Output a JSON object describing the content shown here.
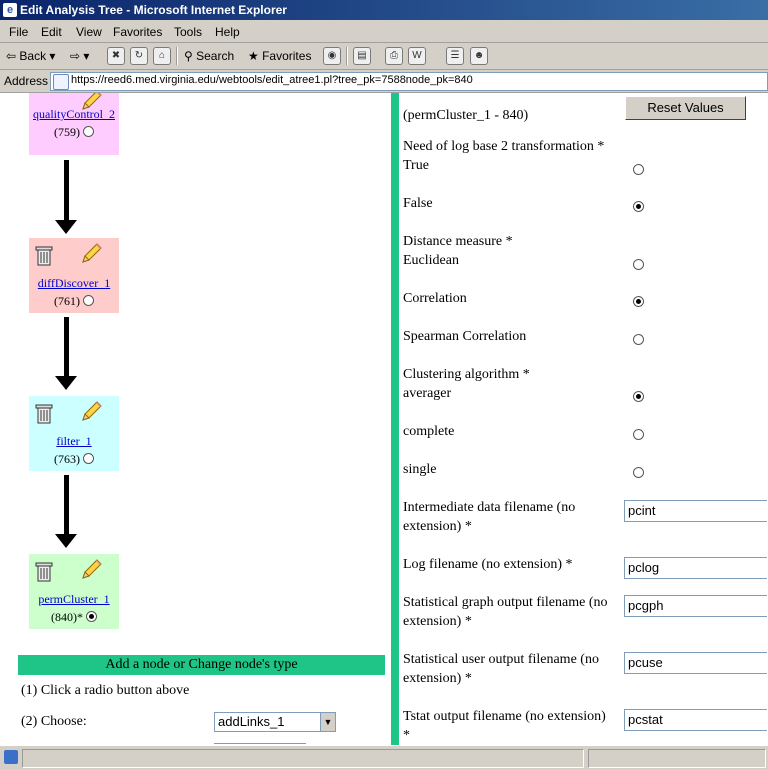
{
  "window": {
    "title": "Edit Analysis Tree - Microsoft Internet Explorer"
  },
  "menu": [
    "File",
    "Edit",
    "View",
    "Favorites",
    "Tools",
    "Help"
  ],
  "toolbar": {
    "back": "Back",
    "search": "Search",
    "favorites": "Favorites"
  },
  "address": {
    "label": "Address",
    "url": "https://reed6.med.virginia.edu/webtools/edit_atree1.pl?tree_pk=7588node_pk=840"
  },
  "tree": {
    "nodes": [
      {
        "name": "qualityControl_2",
        "id": "(759)",
        "color": "#ffccff",
        "selected": false
      },
      {
        "name": "diffDiscover_1",
        "id": "(761)",
        "color": "#ffcccc",
        "selected": false
      },
      {
        "name": "filter_1",
        "id": "(763)",
        "color": "#ccffff",
        "selected": false
      },
      {
        "name": "permCluster_1",
        "id": "(840)*",
        "color": "#ccffcc",
        "selected": true
      }
    ],
    "add_node_header": "Add a node or Change node's type",
    "step1": "(1) Click a radio button above",
    "step2": "(2) Choose:",
    "choose_value": "addLinks_1"
  },
  "form": {
    "reset_label": "Reset Values",
    "node_heading": "(permCluster_1 - 840)",
    "log_transform": {
      "label": "Need of log base 2 transformation *",
      "options": [
        "True",
        "False"
      ],
      "selected": "False"
    },
    "distance": {
      "label": "Distance measure *",
      "options": [
        "Euclidean",
        "Correlation",
        "Spearman Correlation"
      ],
      "selected": "Correlation"
    },
    "clustering": {
      "label": "Clustering algorithm *",
      "options": [
        "averager",
        "complete",
        "single"
      ],
      "selected": "averager"
    },
    "fields": [
      {
        "label1": "Intermediate data filename (no",
        "label2": "extension) *",
        "value": "pcint"
      },
      {
        "label1": "Log filename (no extension) *",
        "label2": "",
        "value": "pclog"
      },
      {
        "label1": "Statistical graph output filename (no",
        "label2": "extension) *",
        "value": "pcgph"
      },
      {
        "label1": "Statistical user output filename (no",
        "label2": "extension) *",
        "value": "pcuse"
      },
      {
        "label1": "Tstat output filename (no extension)",
        "label2": "*",
        "value": "pcstat"
      }
    ]
  },
  "colors": {
    "accent_green": "#1fc487",
    "titlebar": "#0a246a"
  }
}
